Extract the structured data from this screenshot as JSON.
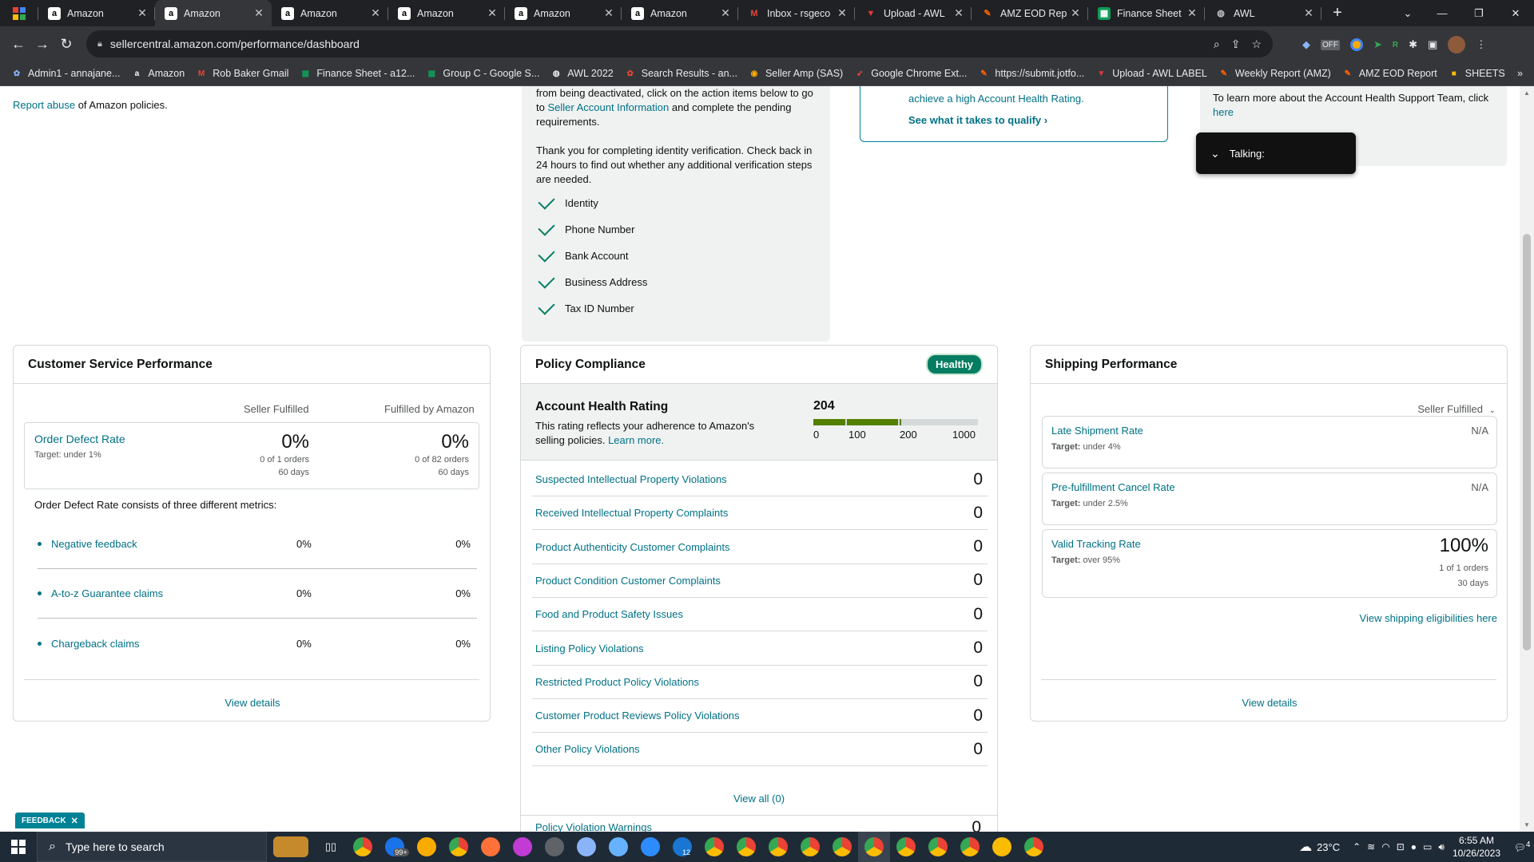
{
  "browser": {
    "tabs": [
      {
        "title": "Amazon",
        "icon": "amazon-icon"
      },
      {
        "title": "Amazon",
        "icon": "amazon-icon",
        "active": true
      },
      {
        "title": "Amazon",
        "icon": "amazon-icon"
      },
      {
        "title": "Amazon",
        "icon": "amazon-icon"
      },
      {
        "title": "Amazon",
        "icon": "amazon-icon"
      },
      {
        "title": "Amazon",
        "icon": "amazon-icon"
      },
      {
        "title": "Inbox - rsgeco",
        "icon": "gmail-icon"
      },
      {
        "title": "Upload - AWL",
        "icon": "upload-icon"
      },
      {
        "title": "AMZ EOD Rep",
        "icon": "jotform-icon"
      },
      {
        "title": "Finance Sheet",
        "icon": "sheets-icon"
      },
      {
        "title": "AWL",
        "icon": "globe-icon"
      }
    ],
    "url": "sellercentral.amazon.com/performance/dashboard",
    "bookmarks": [
      "Admin1 - annajane...",
      "Amazon",
      "Rob Baker Gmail",
      "Finance Sheet - a12...",
      "Group C - Google S...",
      "AWL 2022",
      "Search Results - an...",
      "Seller Amp (SAS)",
      "Google Chrome Ext...",
      "https://submit.jotfo...",
      "Upload - AWL LABEL",
      "Weekly Report (AMZ)",
      "AMZ EOD Report",
      "SHEETS"
    ]
  },
  "top": {
    "report_abuse_link": "Report abuse",
    "report_abuse_rest": "of Amazon policies.",
    "verify_line1": "from being deactivated, click on the action items below to go",
    "verify_line2_pre": "to",
    "verify_line2_link": "Seller Account Information",
    "verify_line2_post": "and complete the pending",
    "verify_line3": "requirements.",
    "thanks": "Thank you for completing identity verification. Check back in 24 hours to find out whether any additional verification steps are needed.",
    "checks": [
      "Identity",
      "Phone Number",
      "Bank Account",
      "Business Address",
      "Tax ID Number"
    ],
    "ahr_text": "achieve a high Account Health Rating.",
    "ahr_link": "See what it takes to qualify",
    "support_text": "To learn more about the Account Health Support Team, click",
    "support_link": "here",
    "talking": "Talking:"
  },
  "csp": {
    "title": "Customer Service Performance",
    "col1": "Seller Fulfilled",
    "col2": "Fulfilled by Amazon",
    "odr_label": "Order Defect Rate",
    "odr_target": "Target: under 1%",
    "odr_sf_val": "0%",
    "odr_sf_orders": "0 of 1 orders",
    "odr_sf_days": "60 days",
    "odr_fba_val": "0%",
    "odr_fba_orders": "0 of 82 orders",
    "odr_fba_days": "60 days",
    "consists": "Order Defect Rate consists of three different metrics:",
    "metrics": [
      {
        "label": "Negative feedback",
        "sf": "0%",
        "fba": "0%"
      },
      {
        "label": "A-to-z Guarantee claims",
        "sf": "0%",
        "fba": "0%"
      },
      {
        "label": "Chargeback claims",
        "sf": "0%",
        "fba": "0%"
      }
    ],
    "view_details": "View details"
  },
  "policy": {
    "title": "Policy Compliance",
    "badge": "Healthy",
    "ahr_title": "Account Health Rating",
    "ahr_desc": "This rating reflects your adherence to Amazon's selling policies.",
    "ahr_learn": "Learn more.",
    "score": "204",
    "ticks": [
      "0",
      "100",
      "200",
      "1000"
    ],
    "rows": [
      {
        "label": "Suspected Intellectual Property Violations",
        "count": "0"
      },
      {
        "label": "Received Intellectual Property Complaints",
        "count": "0"
      },
      {
        "label": "Product Authenticity Customer Complaints",
        "count": "0"
      },
      {
        "label": "Product Condition Customer Complaints",
        "count": "0"
      },
      {
        "label": "Food and Product Safety Issues",
        "count": "0"
      },
      {
        "label": "Listing Policy Violations",
        "count": "0"
      },
      {
        "label": "Restricted Product Policy Violations",
        "count": "0"
      },
      {
        "label": "Customer Product Reviews Policy Violations",
        "count": "0"
      },
      {
        "label": "Other Policy Violations",
        "count": "0"
      }
    ],
    "view_all": "View all (0)",
    "warnings_partial": "Policy Violation Warnings",
    "warnings_count": "0"
  },
  "shipping": {
    "title": "Shipping Performance",
    "filter": "Seller Fulfilled",
    "metrics": [
      {
        "label": "Late Shipment Rate",
        "target_label": "Target:",
        "target": "under 4%",
        "value": "N/A"
      },
      {
        "label": "Pre-fulfillment Cancel Rate",
        "target_label": "Target:",
        "target": "under 2.5%",
        "value": "N/A"
      },
      {
        "label": "Valid Tracking Rate",
        "target_label": "Target:",
        "target": "over 95%",
        "value": "100%",
        "orders": "1 of 1 orders",
        "days": "30 days"
      }
    ],
    "eligibilities": "View shipping eligibilities here",
    "view_details": "View details"
  },
  "feedback": "FEEDBACK",
  "taskbar": {
    "search_placeholder": "Type here to search",
    "badge_99": "99+",
    "badge_12": "12",
    "weather": "23°C",
    "time": "6:55 AM",
    "date": "10/26/2023",
    "notif": "4"
  },
  "colors": {
    "teal": "#007185",
    "healthy": "#067d62",
    "accent_bar": "#008296"
  }
}
